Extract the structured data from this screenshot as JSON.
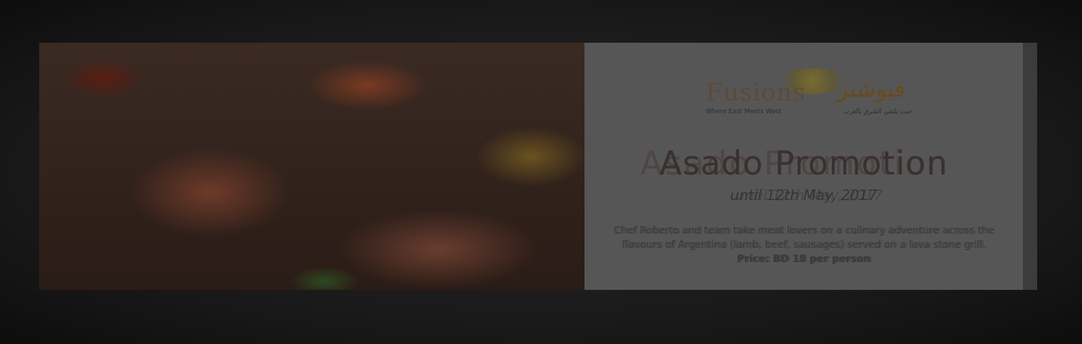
{
  "logo": {
    "name_en": "Fusions",
    "name_ar": "فيوشنز",
    "tagline_en": "Where East Meets West",
    "tagline_ar": "حيث يلتقي الشرق بالغرب"
  },
  "promo": {
    "title": "Asado Promotion",
    "date": "until 12th May, 2017",
    "description": "Chef Roberto and team take meat lovers on a culinary adventure across the flavours of Argentina (lamb, beef, sausages) served on a lava stone grill.",
    "price": "Price: BD 18 per person"
  },
  "colors": {
    "panel": "#565656",
    "background": "#161616"
  },
  "image": {
    "subject": "grilled-steaks-photo"
  }
}
